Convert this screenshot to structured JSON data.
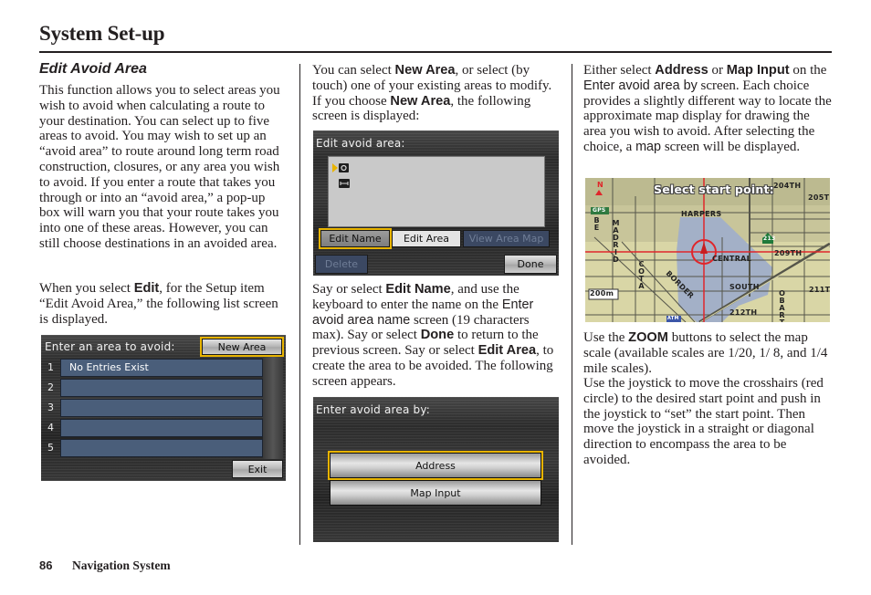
{
  "page": {
    "title": "System Set-up",
    "page_number": "86",
    "footer_label": "Navigation System"
  },
  "col1": {
    "heading": "Edit Avoid Area",
    "intro": "This function allows you to select areas you wish to avoid when calculating a route to your destination. You can select up to five areas to avoid. You may wish to set up an “avoid area” to route around long term road construction, closures, or any area you wish to avoid. If you enter a route that takes you through or into an “avoid area,” a pop-up box will warn you that your route takes you into one of these areas. However, you can still choose destinations in an avoided area.",
    "p2_a": "When you select ",
    "p2_b": "Edit",
    "p2_c": ", for the Setup item “Edit Avoid Area,” the following list screen is displayed."
  },
  "screen1": {
    "title": "Enter an area to avoid:",
    "new_area_label": "New Area",
    "exit_label": "Exit",
    "rows": [
      {
        "num": "1",
        "text": "No Entries Exist"
      },
      {
        "num": "2",
        "text": ""
      },
      {
        "num": "3",
        "text": ""
      },
      {
        "num": "4",
        "text": ""
      },
      {
        "num": "5",
        "text": ""
      }
    ]
  },
  "col2": {
    "p1_a": "You can select ",
    "p1_b": "New Area",
    "p1_c": ", or select (by touch) one of your existing areas to modify. If you choose ",
    "p1_d": "New Area",
    "p1_e": ", the following screen is displayed:",
    "p2_a": "Say or select ",
    "p2_b": "Edit Name",
    "p2_c": ", and use the keyboard to enter the name on the ",
    "p2_d": "Enter avoid area name",
    "p2_e": " screen (19 characters max). Say or select ",
    "p2_f": "Done",
    "p2_g": " to return to the previous screen. Say or select ",
    "p2_h": "Edit Area",
    "p2_i": ", to create the area to be avoided. The following screen appears."
  },
  "screen2": {
    "title": "Edit avoid area:",
    "edit_name_label": "Edit Name",
    "edit_area_label": "Edit Area",
    "view_area_map_label": "View Area Map",
    "delete_label": "Delete",
    "done_label": "Done",
    "icons": [
      "name-icon",
      "area-size-icon"
    ]
  },
  "screen3": {
    "title": "Enter avoid area by:",
    "address_label": "Address",
    "map_input_label": "Map Input"
  },
  "col3": {
    "p1_a": "Either select ",
    "p1_b": "Address",
    "p1_c": " or ",
    "p1_d": "Map Input",
    "p1_e": " on the ",
    "p1_f": "Enter avoid area by",
    "p1_g": " screen. Each choice provides a slightly different way to locate the approximate map display for drawing the area you wish to avoid. After selecting the choice, a ",
    "p1_h": "map",
    "p1_i": " screen will be displayed.",
    "p2_a": "Use the ",
    "p2_b": "ZOOM",
    "p2_c": " buttons to select the map scale (available scales are 1/20, 1/ 8, and 1/4 mile scales).",
    "p3": "Use the joystick to move the crosshairs (red circle) to the desired start point and push in the joystick to “set” the start point. Then move the joystick in a straight or diagonal direction to encompass the area to be avoided."
  },
  "map": {
    "title": "Select start point:",
    "north_label": "N",
    "gps_label": "GPS",
    "scale_label": "200m",
    "highway_label": "213",
    "atm_label": "ATM",
    "streets": {
      "s204": "204TH",
      "s205": "205T",
      "harpers": "HARPERS",
      "s209": "209TH",
      "central": "CENTRAL",
      "south": "SOUTH",
      "s211": "211T",
      "s212": "212TH",
      "border": "BORDER",
      "beech": "BE",
      "madrid": "MADRID",
      "cota": "COTA",
      "hobart": "OBART"
    },
    "colors": {
      "land": "#d9d6a6",
      "avoid_area": "#a3b0c7",
      "crosshair": "#e0262b",
      "road": "#4a4a44"
    }
  },
  "colors": {
    "highlight": "#e8b400",
    "list_row": "#4a5e7a",
    "text": "#231f20"
  }
}
